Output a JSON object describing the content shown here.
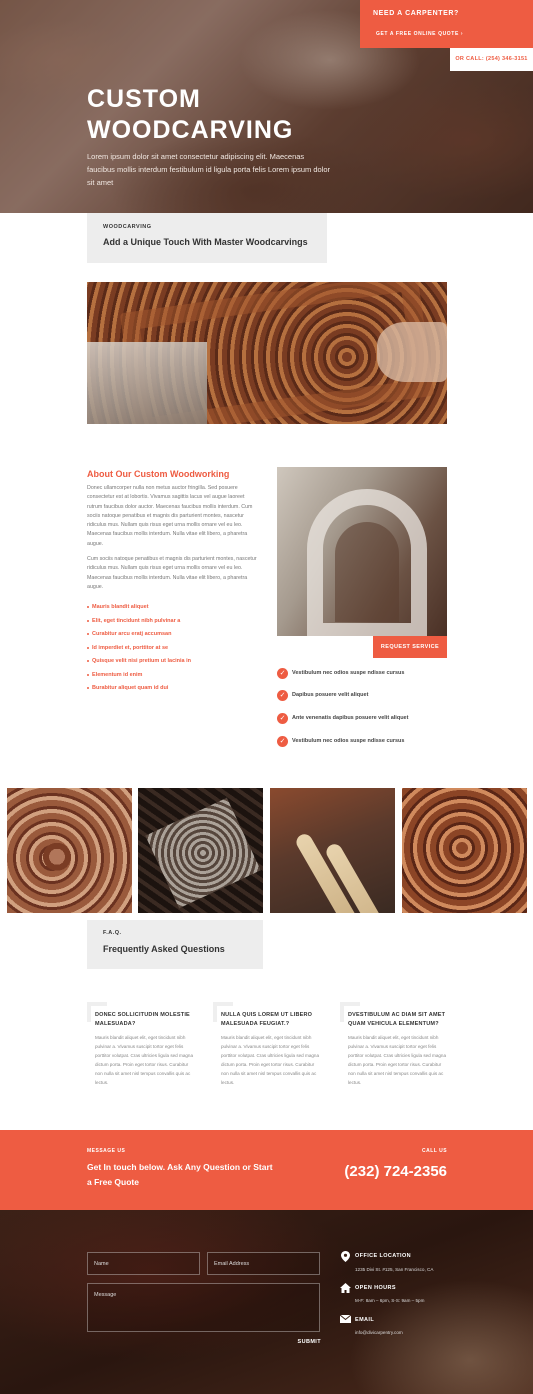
{
  "hero": {
    "title_line1": "CUSTOM",
    "title_line2": "WOODCARVING",
    "subtitle": "Lorem ipsum dolor sit amet consectetur adipiscing elit. Maecenas faucibus mollis interdum festibulum id ligula porta felis Lorem ipsum dolor sit amet"
  },
  "cta": {
    "title": "NEED A CARPENTER?",
    "link": "GET A FREE ONLINE QUOTE ›",
    "phone": "OR CALL: (254) 346-3151"
  },
  "intro": {
    "eyebrow": "WOODCARVING",
    "title": "Add a Unique Touch With Master Woodcarvings"
  },
  "about": {
    "heading": "About Our Custom Woodworking",
    "para1": "Donec ullamcorper nulla non metus auctor fringilla. Sed posuere consectetur est at lobortis. Vivamus sagittis lacus vel augue laoreet rutrum faucibus dolor auctor. Maecenas faucibus mollis interdum. Cum sociis natoque penatibus et magnis dis parturient montes, nascetur ridiculus mus. Nullam quis risus eget urna mollis ornare vel eu leo. Maecenas faucibus mollis interdum. Nulla vitae elit libero, a pharetra augue.",
    "para2": "Cum sociis natoque penatibus et magnis dis parturient montes, nascetur ridiculus mus. Nullam quis risus eget urna mollis ornare vel eu leo. Maecenas faucibus mollis interdum. Nulla vitae elit libero, a pharetra augue.",
    "bullets": [
      "Mauris blandit aliquet",
      "Elit, eget tincidunt nibh pulvinar a",
      "Curabitur arcu eratj accumsan",
      "Id imperdiet et, porttitor at se",
      "Quisque velit nisi pretium ut lacinia in",
      "Elementum id enim",
      "Burabitur aliquet quam id dui"
    ],
    "request_button": "REQUEST SERVICE",
    "checklist": [
      "Vestibulum nec odios suspe ndisse cursus",
      "Dapibus posuere velit aliquet",
      "Ante venenatis dapibus posuere velit aliquet",
      "Vestibulum nec odios suspe ndisse cursus"
    ]
  },
  "faq": {
    "eyebrow": "F.A.Q.",
    "title": "Frequently Asked Questions",
    "items": [
      {
        "question": "DONEC SOLLICITUDIN MOLESTIE MALESUADA?",
        "answer": "Mauris blandit aliquet elit, eget tincidunt nibh pulvinar a. Vivamus suscipit tortor eget felis porttitor volutpat. Cras ultricies ligula sed magna dictum porta. Proin eget tortor risus. Curabitur non nulla sit amet nisl tempus convallis quis ac lectus."
      },
      {
        "question": "NULLA QUIS LOREM UT LIBERO MALESUADA FEUGIAT.?",
        "answer": "Mauris blandit aliquet elit, eget tincidunt nibh pulvinar a. Vivamus suscipit tortor eget felis porttitor volutpat. Cras ultricies ligula sed magna dictum porta. Proin eget tortor risus. Curabitur non nulla sit amet nisl tempus convallis quis ac lectus."
      },
      {
        "question": "DVESTIBULUM AC DIAM SIT AMET QUAM VEHICULA ELEMENTUM?",
        "answer": "Mauris blandit aliquet elit, eget tincidunt nibh pulvinar a. Vivamus suscipit tortor eget felis porttitor volutpat. Cras ultricies ligula sed magna dictum porta. Proin eget tortor risus. Curabitur non nulla sit amet nisl tempus convallis quis ac lectus."
      }
    ]
  },
  "contact": {
    "message_label": "MESSAGE US",
    "message_title": "Get In touch below. Ask Any Question or Start a Free Quote",
    "call_label": "CALL US",
    "phone": "(232) 724-2356"
  },
  "form": {
    "name_placeholder": "Name",
    "email_placeholder": "Email Address",
    "message_placeholder": "Message",
    "submit": "SUBMIT"
  },
  "info": {
    "location_label": "OFFICE LOCATION",
    "location_value": "1235 Divi St. #125, San Francisco, CA",
    "hours_label": "OPEN HOURS",
    "hours_value": "M-F: 8am – 6pm, S-S: 9am – 5pm",
    "email_label": "EMAIL",
    "email_value": "info@divicarpentry.com"
  },
  "colors": {
    "accent": "#ee5c42",
    "light_gray": "#ededed"
  }
}
